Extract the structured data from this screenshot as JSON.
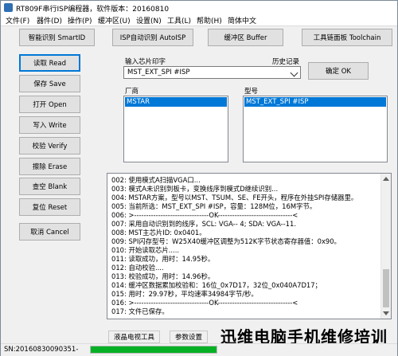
{
  "window": {
    "title": "RT809F串行ISP编程器，软件版本：20160810"
  },
  "menu": [
    "文件(F)",
    "器件(D)",
    "操作(P)",
    "缓冲区(U)",
    "设置(N)",
    "工具(L)",
    "帮助(H)",
    "简体中文"
  ],
  "toolbar": {
    "smart_id": "智能识别 SmartID",
    "auto_isp": "ISP自动识别 AutoISP",
    "buffer": "缓冲区 Buffer",
    "toolchain": "工具链面板 Toolchain"
  },
  "actions": {
    "read": "读取 Read",
    "save": "保存 Save",
    "open": "打开 Open",
    "write": "写入 Write",
    "verify": "校验 Verify",
    "erase": "擦除 Erase",
    "blank": "查空 Blank",
    "reset": "复位 Reset",
    "cancel": "取消 Cancel"
  },
  "chip": {
    "input_label": "输入芯片印字",
    "history_label": "历史记录",
    "value": "MST_EXT_SPI #ISP",
    "ok_button": "确定 OK"
  },
  "vendor": {
    "label": "厂商",
    "selected": "MSTAR"
  },
  "model": {
    "label": "型号",
    "selected": "MST_EXT_SPI #ISP"
  },
  "log": [
    "002: 使用模式A扫描VGA口...",
    "003: 模式A未识别到板卡，变换线序到模式D继续识别...",
    "004: MSTAR方案，型号以MST、TSUM、SE、FE开头，程序在外挂SPI存储器里。",
    "005: 当前所选：MST_EXT_SPI #ISP，容量：128M位，16M字节。",
    "006: >-------------------------------OK-------------------------------<",
    "007: 采用自动识别到的线序，SCL: VGA-- 4; SDA: VGA--11.",
    "008: MST主芯片ID: 0x0401。",
    "009: SPI闪存型号：W25X40缓冲区调整为512K字节状态寄存器值：0x90。",
    "010: 开始读取芯片.....",
    "011: 读取成功，用时：14.95秒。",
    "012: 自动校验....",
    "013: 校验成功，用时：14.96秒。",
    "014: 缓冲区数据累加校验和：16位_0x7D17，32位_0x040A7D17；",
    "015: 用时：29.97秒，平均速率34984字节/秒。",
    "016: >-------------------------------OK-------------------------------<",
    "017: 文件已保存。"
  ],
  "bottom_tabs": {
    "lcd_tools": "液晶电视工具",
    "params": "参数设置"
  },
  "status": {
    "serial": "SN:20160830090351-",
    "progress": 1.0
  },
  "watermark": "迅维电脑手机维修培训",
  "colors": {
    "selection": "#0078d7",
    "progress": "#06b025"
  }
}
